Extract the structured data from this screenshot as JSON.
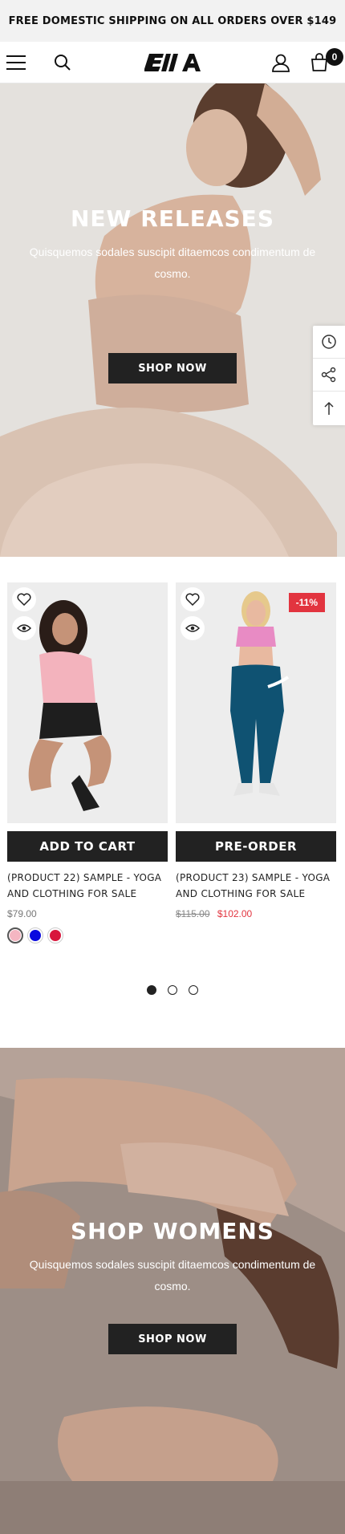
{
  "announcement": "FREE DOMESTIC SHIPPING ON ALL ORDERS OVER $149",
  "header": {
    "logo_text": "EllA",
    "cart_count": "0"
  },
  "hero_top": {
    "title": "NEW RELEASES",
    "text": "Quisquemos sodales suscipit ditaemcos condimentum de cosmo.",
    "button": "SHOP NOW"
  },
  "products": [
    {
      "button": "ADD TO CART",
      "title": "(PRODUCT 22) SAMPLE - YOGA AND CLOTHING FOR SALE",
      "price": "$79.00",
      "swatches": [
        "#f4b6c2",
        "#0a0adf",
        "#d8163c"
      ]
    },
    {
      "badge": "-11%",
      "button": "PRE-ORDER",
      "title": "(PRODUCT 23) SAMPLE - YOGA AND CLOTHING FOR SALE",
      "old_price": "$115.00",
      "sale_price": "$102.00"
    }
  ],
  "carousel": {
    "pages": 3,
    "active": 0
  },
  "hero_bottom": {
    "title": "SHOP WOMENS",
    "text": "Quisquemos sodales suscipit ditaemcos condimentum de cosmo.",
    "button": "SHOP NOW"
  },
  "colors": {
    "dark": "#222222",
    "sale": "#e2343f",
    "announce_bg": "#f2f2f2"
  }
}
